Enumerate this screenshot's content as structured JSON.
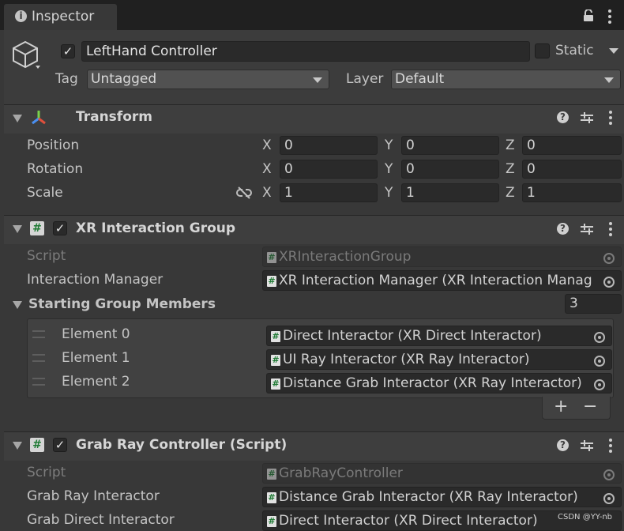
{
  "tab": {
    "title": "Inspector"
  },
  "header": {
    "object_name": "LeftHand Controller",
    "static_label": "Static",
    "tag_label": "Tag",
    "tag_value": "Untagged",
    "layer_label": "Layer",
    "layer_value": "Default"
  },
  "transform": {
    "title": "Transform",
    "rows": [
      {
        "label": "Position",
        "x": "0",
        "y": "0",
        "z": "0"
      },
      {
        "label": "Rotation",
        "x": "0",
        "y": "0",
        "z": "0"
      },
      {
        "label": "Scale",
        "x": "1",
        "y": "1",
        "z": "1"
      }
    ],
    "axis": {
      "x": "X",
      "y": "Y",
      "z": "Z"
    }
  },
  "xr_group": {
    "title": "XR Interaction Group",
    "script_label": "Script",
    "script_value": "XRInteractionGroup",
    "manager_label": "Interaction Manager",
    "manager_value": "XR Interaction Manager (XR Interaction Manag",
    "members_label": "Starting Group Members",
    "members_count": "3",
    "elements": [
      {
        "label": "Element 0",
        "value": "Direct Interactor (XR Direct Interactor)"
      },
      {
        "label": "Element 1",
        "value": "UI Ray Interactor (XR Ray Interactor)"
      },
      {
        "label": "Element 2",
        "value": "Distance Grab Interactor  (XR Ray Interactor)"
      }
    ],
    "add": "+",
    "remove": "−"
  },
  "grab_ray": {
    "title": "Grab Ray Controller (Script)",
    "script_label": "Script",
    "script_value": "GrabRayController",
    "ray_label": "Grab Ray Interactor",
    "ray_value": "Distance Grab Interactor  (XR Ray Interactor)",
    "direct_label": "Grab Direct Interactor",
    "direct_value": "Direct Interactor (XR Direct Interactor)"
  },
  "watermark": "CSDN @YY-nb",
  "icons": [
    "info-icon",
    "lock-icon",
    "kebab-menu-icon",
    "cube-icon",
    "transform-icon",
    "script-hash-icon",
    "help-icon",
    "preset-icon",
    "unlink-icon",
    "target-icon"
  ]
}
